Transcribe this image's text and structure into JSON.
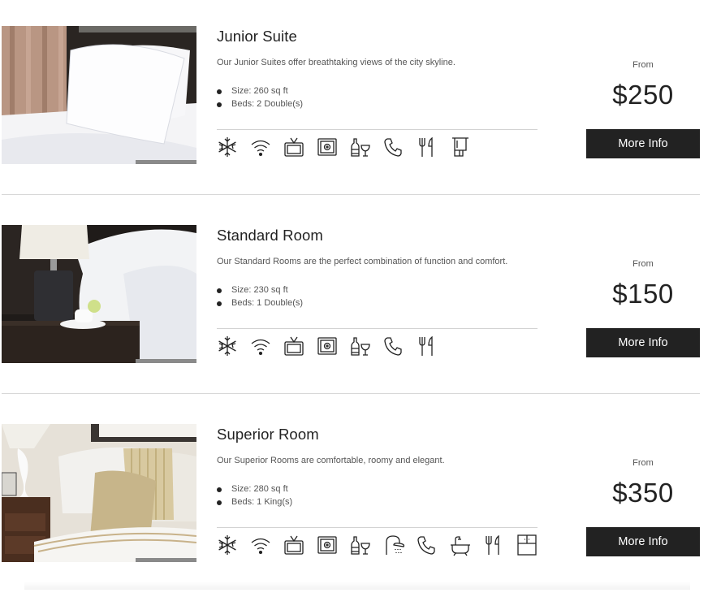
{
  "rooms": [
    {
      "title": "Junior Suite",
      "description": "Our Junior Suites offer breathtaking views of the city skyline.",
      "size": "Size: 260 sq ft",
      "beds": "Beds: 2 Double(s)",
      "from_label": "From",
      "price": "$250",
      "button_label": "More Info",
      "amenities": [
        "snowflake-icon",
        "wifi-icon",
        "tv-icon",
        "safe-icon",
        "minibar-icon",
        "phone-icon",
        "dining-icon",
        "towel-icon"
      ]
    },
    {
      "title": "Standard Room",
      "description": "Our Standard Rooms are the perfect combination of function and comfort.",
      "size": "Size: 230 sq ft",
      "beds": "Beds: 1 Double(s)",
      "from_label": "From",
      "price": "$150",
      "button_label": "More Info",
      "amenities": [
        "snowflake-icon",
        "wifi-icon",
        "tv-icon",
        "safe-icon",
        "minibar-icon",
        "phone-icon",
        "dining-icon"
      ]
    },
    {
      "title": "Superior Room",
      "description": "Our Superior Rooms are comfortable, roomy and elegant.",
      "size": "Size: 280 sq ft",
      "beds": "Beds: 1 King(s)",
      "from_label": "From",
      "price": "$350",
      "button_label": "More Info",
      "amenities": [
        "snowflake-icon",
        "wifi-icon",
        "tv-icon",
        "safe-icon",
        "minibar-icon",
        "shower-icon",
        "phone-icon",
        "bathtub-icon",
        "dining-icon",
        "wardrobe-icon"
      ]
    }
  ],
  "colors": {
    "button_bg": "#222222",
    "button_text": "#ffffff",
    "divider": "#d8d8d8",
    "text": "#222222",
    "muted_text": "#555555"
  }
}
